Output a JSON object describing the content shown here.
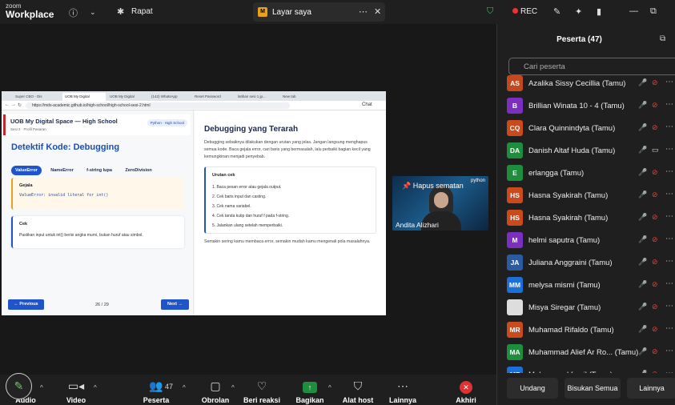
{
  "app": {
    "logo_line1": "zoom",
    "logo_line2": "Workplace",
    "meeting_label": "Rapat",
    "share_title": "Layar saya",
    "share_badge": "M",
    "rec_label": "REC"
  },
  "browser": {
    "tabs": [
      "Super CBO - Dis",
      "UOB My Digital",
      "UOB My Digital",
      "(142) WhatsApp",
      "Reset Password",
      "latihan sesi 1 jp...",
      "New tab"
    ],
    "url": "https://mds-academic.github.io/high-school/high-school-sesi-2.html",
    "chat_label": "Chat"
  },
  "slide_left": {
    "header_title": "UOB My Digital Space — High School",
    "header_sub": "Sesi 2 · Profil Pasaran",
    "badge": "Python · High School",
    "heading": "Detektif Kode: Debugging",
    "chips": [
      "ValueError",
      "NameError",
      "f-string lupa",
      "ZeroDivision"
    ],
    "card1_title": "Gejala",
    "card1_code": "ValueError: invalid literal for int()",
    "card2_title": "Cek",
    "card2_text": "Pastikan input untuk  int()  berisi angka murni, bukan huruf atau simbol.",
    "prev": "← Previous",
    "page": "26 / 29",
    "next": "Next →"
  },
  "slide_right": {
    "heading": "Debugging yang Terarah",
    "intro": "Debugging sebaiknya dilakukan dengan urutan yang jelas. Jangan langsung menghapus semua kode. Baca gejala error, cari baris yang bermasalah, lalu perbaiki bagian kecil yang kemungkinan menjadi penyebab.",
    "box_title": "Urutan cek",
    "steps": [
      "1. Baca pesan error atau gejala output.",
      "2. Cek baris input dan casting.",
      "3. Cek nama variabel.",
      "4. Cek tanda kutip dan huruf  f  pada f-string.",
      "5. Jalankan ulang setelah memperbaiki."
    ],
    "footer": "Semakin sering kamu membaca error, semakin mudah kamu mengenali pola masalahnya."
  },
  "video": {
    "pin_label": "Hapus sematan",
    "name": "Andita Alizhari",
    "brand": "python"
  },
  "participants": {
    "title": "Peserta (47)",
    "search_placeholder": "Cari peserta",
    "list": [
      {
        "initials": "AS",
        "name": "Azalika Sissy Cecillia (Tamu)",
        "color": "#c2491d",
        "video": "off"
      },
      {
        "initials": "B",
        "name": "Brillian Winata 10 - 4 (Tamu)",
        "color": "#7b2fbf",
        "video": "off"
      },
      {
        "initials": "CQ",
        "name": "Clara Quinnindyta (Tamu)",
        "color": "#c94a1c",
        "video": "off"
      },
      {
        "initials": "DA",
        "name": "Danish Altaf Huda (Tamu)",
        "color": "#1e8e3e",
        "video": "on"
      },
      {
        "initials": "E",
        "name": "erlangga (Tamu)",
        "color": "#1e8e3e",
        "video": "off"
      },
      {
        "initials": "HS",
        "name": "Hasna Syakirah (Tamu)",
        "color": "#c94a1c",
        "video": "off"
      },
      {
        "initials": "HS",
        "name": "Hasna Syakirah (Tamu)",
        "color": "#c94a1c",
        "video": "off"
      },
      {
        "initials": "M",
        "name": "helmi saputra (Tamu)",
        "color": "#7b2fbf",
        "video": "off"
      },
      {
        "initials": "JA",
        "name": "Juliana Anggraini (Tamu)",
        "color": "#2c5aa0",
        "video": "off"
      },
      {
        "initials": "MM",
        "name": "melysa mismi (Tamu)",
        "color": "#1d6fd6",
        "video": "off"
      },
      {
        "initials": "",
        "name": "Misya Siregar (Tamu)",
        "color": "#ddd",
        "video": "off"
      },
      {
        "initials": "MR",
        "name": "Muhamad Rifaldo (Tamu)",
        "color": "#c94a1c",
        "video": "off"
      },
      {
        "initials": "MA",
        "name": "Muhammad Alief Ar Ro... (Tamu)",
        "color": "#1e8e3e",
        "video": "off"
      },
      {
        "initials": "MF",
        "name": "Muhammad fazril (Tamu)",
        "color": "#1d6fd6",
        "video": "off"
      }
    ],
    "invite": "Undang",
    "mute_all": "Bisukan Semua",
    "more": "Lainnya"
  },
  "toolbar": {
    "audio": "Audio",
    "video": "Video",
    "participants": "Peserta",
    "participant_count": "47",
    "chat": "Obrolan",
    "reactions": "Beri reaksi",
    "share": "Bagikan",
    "host_tools": "Alat host",
    "more": "Lainnya",
    "end": "Akhiri"
  }
}
